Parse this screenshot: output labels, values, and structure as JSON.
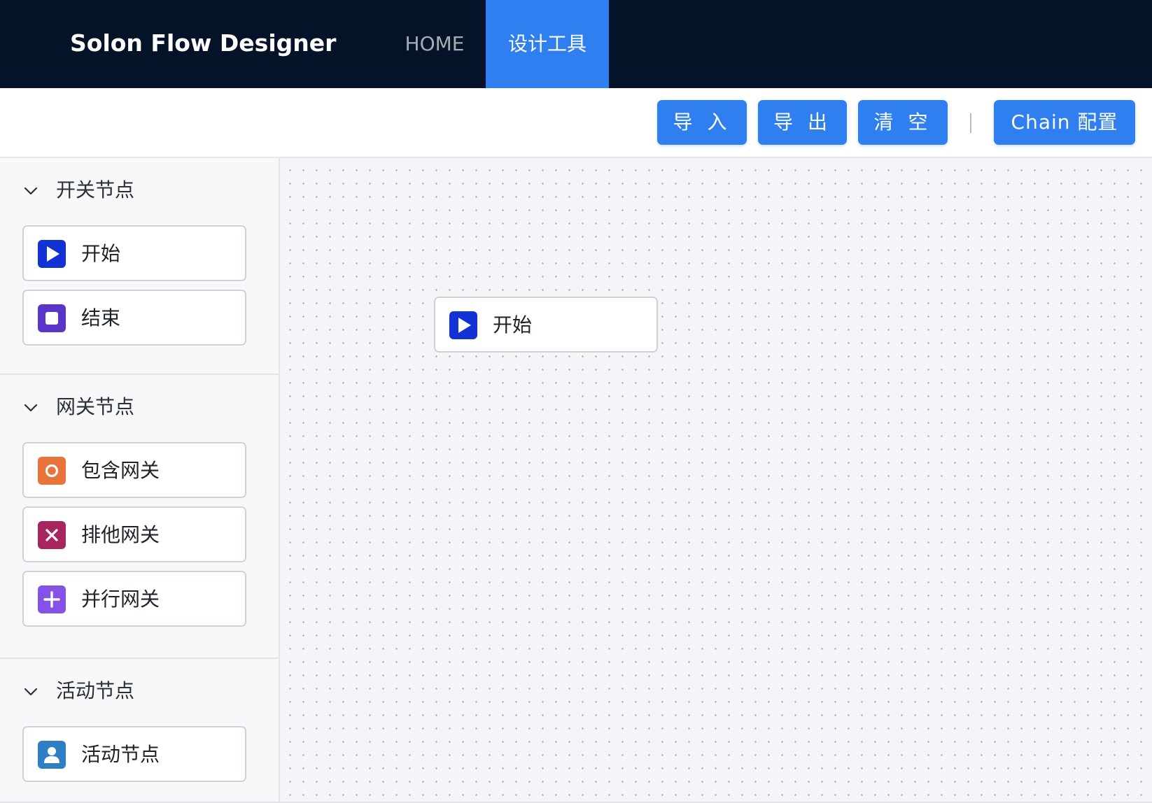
{
  "header": {
    "app_title": "Solon Flow Designer",
    "nav": [
      {
        "label": "HOME",
        "active": false
      },
      {
        "label": "设计工具",
        "active": true
      }
    ]
  },
  "toolbar": {
    "import_label": "导 入",
    "export_label": "导 出",
    "clear_label": "清 空",
    "separator": "|",
    "chain_config_label": "Chain 配置"
  },
  "sidebar": {
    "groups": [
      {
        "title": "开关节点",
        "expanded": true,
        "items": [
          {
            "label": "开始",
            "icon": "play-icon",
            "color": "#1332d6"
          },
          {
            "label": "结束",
            "icon": "stop-icon",
            "color": "#5a35c9"
          }
        ]
      },
      {
        "title": "网关节点",
        "expanded": true,
        "items": [
          {
            "label": "包含网关",
            "icon": "circle-icon",
            "color": "#e8743b"
          },
          {
            "label": "排他网关",
            "icon": "close-icon",
            "color": "#a8265f"
          },
          {
            "label": "并行网关",
            "icon": "plus-icon",
            "color": "#8452e6"
          }
        ]
      },
      {
        "title": "活动节点",
        "expanded": true,
        "items": [
          {
            "label": "活动节点",
            "icon": "user-icon",
            "color": "#2e7ec5"
          }
        ]
      }
    ]
  },
  "canvas": {
    "nodes": [
      {
        "label": "开始",
        "icon": "play-icon",
        "color": "#1332d6"
      }
    ]
  },
  "colors": {
    "header_bg": "#051329",
    "accent": "#2f7ff0",
    "canvas_bg": "#f3f5f8"
  }
}
